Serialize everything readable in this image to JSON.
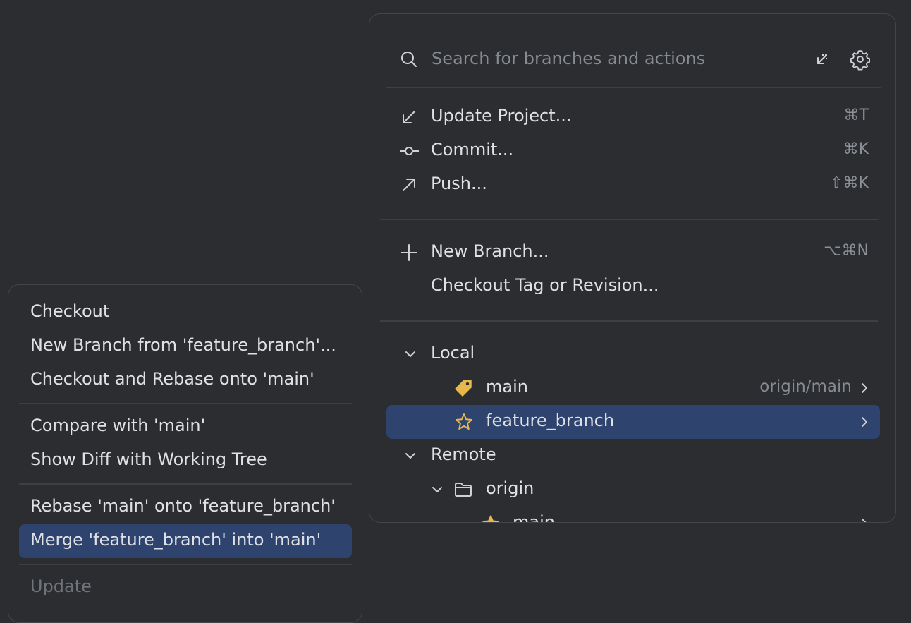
{
  "search": {
    "placeholder": "Search for branches and actions"
  },
  "actions": [
    {
      "label": "Update Project...",
      "shortcut": "⌘T",
      "icon": "update-arrow-icon"
    },
    {
      "label": "Commit...",
      "shortcut": "⌘K",
      "icon": "commit-icon"
    },
    {
      "label": "Push...",
      "shortcut": "⇧⌘K",
      "icon": "push-arrow-icon"
    },
    {
      "label": "New Branch...",
      "shortcut": "⌥⌘N",
      "icon": "plus-icon"
    },
    {
      "label": "Checkout Tag or Revision...",
      "shortcut": "",
      "icon": ""
    }
  ],
  "tree": {
    "local": {
      "label": "Local",
      "branches": [
        {
          "name": "main",
          "tracking": "origin/main",
          "icon": "tag-icon",
          "color": "#e8b84a"
        },
        {
          "name": "feature_branch",
          "tracking": "",
          "icon": "star-outline-icon",
          "color": "#e8b84a"
        }
      ]
    },
    "remote": {
      "label": "Remote",
      "origin": {
        "label": "origin",
        "branches": [
          {
            "name": "main",
            "icon": "star-filled-icon"
          }
        ]
      }
    }
  },
  "context_menu": {
    "items": [
      {
        "label": "Checkout"
      },
      {
        "label": "New Branch from 'feature_branch'..."
      },
      {
        "label": "Checkout and Rebase onto 'main'"
      },
      {
        "label": "Compare with 'main'"
      },
      {
        "label": "Show Diff with Working Tree"
      },
      {
        "label": "Rebase 'main' onto 'feature_branch'"
      },
      {
        "label": "Merge 'feature_branch' into 'main'"
      },
      {
        "label": "Update"
      }
    ]
  },
  "colors": {
    "background": "#2b2d30",
    "selection": "#2e436e",
    "text": "#dfe1e5",
    "muted_text": "#868a91",
    "branch_icon": "#e8b84a"
  }
}
